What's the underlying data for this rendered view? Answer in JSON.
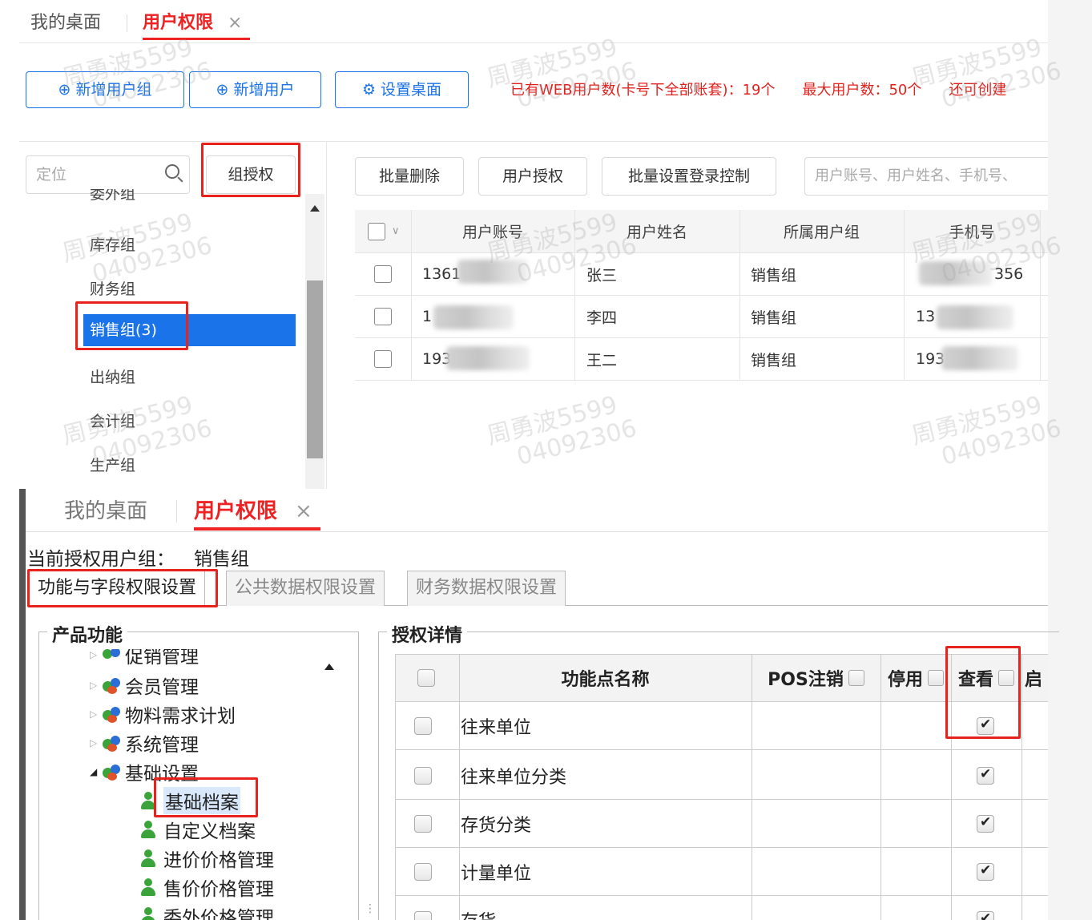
{
  "top_panel": {
    "tabs": {
      "home": "我的桌面",
      "active": "用户权限",
      "close": "×"
    },
    "toolbar": {
      "add_group": "新增用户组",
      "add_user": "新增用户",
      "set_desktop": "设置桌面"
    },
    "stats": {
      "web_users": "已有WEB用户数(卡号下全部账套)：19个",
      "max_users": "最大用户数：50个",
      "remaining": "还可创建"
    },
    "group_search_placeholder": "定位",
    "group_auth": "组授权",
    "groups": [
      "委外组",
      "库存组",
      "财务组",
      "销售组(3)",
      "出纳组",
      "会计组",
      "生产组"
    ],
    "actions": {
      "batch_delete": "批量删除",
      "user_auth": "用户授权",
      "batch_login": "批量设置登录控制",
      "user_search_placeholder": "用户账号、用户姓名、手机号、"
    },
    "table": {
      "columns": [
        "用户账号",
        "用户姓名",
        "所属用户组",
        "手机号"
      ],
      "rows": [
        {
          "account": "1361",
          "name": "张三",
          "group": "销售组",
          "phone": "356"
        },
        {
          "account": "1",
          "name": "李四",
          "group": "销售组",
          "phone": "13"
        },
        {
          "account": "193",
          "name": "王二",
          "group": "销售组",
          "phone": "193"
        }
      ]
    },
    "watermark": {
      "name": "周勇波5599",
      "number": "04092306"
    }
  },
  "bottom_panel": {
    "tabs": {
      "home": "我的桌面",
      "active": "用户权限",
      "close": "×"
    },
    "current_group_label": "当前授权用户组：",
    "current_group": "销售组",
    "sub_tabs": [
      "功能与字段权限设置",
      "公共数据权限设置",
      "财务数据权限设置"
    ],
    "product_legend": "产品功能",
    "tree": {
      "top_cut": "促销管理",
      "groups": [
        "会员管理",
        "物料需求计划",
        "系统管理",
        "基础设置"
      ],
      "children": [
        "基础档案",
        "自定义档案",
        "进价价格管理",
        "售价价格管理",
        "委外价格管理"
      ]
    },
    "detail_legend": "授权详情",
    "detail_table": {
      "columns": [
        "功能点名称",
        "POS注销",
        "停用",
        "查看",
        "启"
      ],
      "rows": [
        {
          "name": "往来单位",
          "view": true
        },
        {
          "name": "往来单位分类",
          "view": true
        },
        {
          "name": "存货分类",
          "view": true
        },
        {
          "name": "计量单位",
          "view": true
        },
        {
          "name": "存货",
          "view": true
        }
      ]
    }
  }
}
